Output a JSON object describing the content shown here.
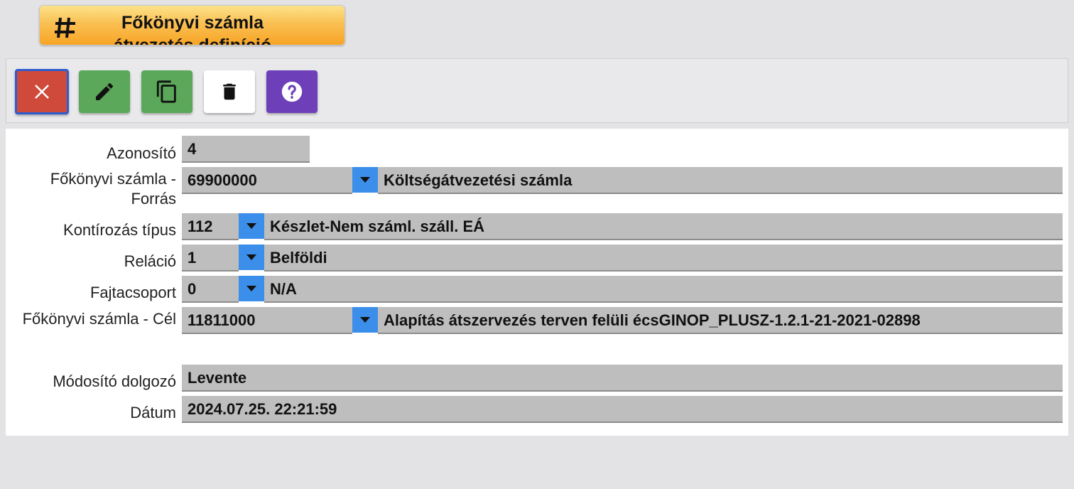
{
  "tab": {
    "title": "Főkönyvi számla átvezetés definíció",
    "icon": "hashtag-icon"
  },
  "toolbar": {
    "close": {
      "icon": "close-icon",
      "color": "#d04a3b"
    },
    "edit": {
      "icon": "pencil-icon",
      "color": "#5ba85a"
    },
    "copy": {
      "icon": "copy-icon",
      "color": "#5ba85a"
    },
    "delete": {
      "icon": "trash-icon",
      "color": "#ffffff"
    },
    "help": {
      "icon": "help-icon",
      "color": "#6d3fb8"
    }
  },
  "form": {
    "id": {
      "label": "Azonosító",
      "value": "4"
    },
    "source_account": {
      "label": "Főkönyvi számla - Forrás",
      "code": "69900000",
      "name": "Költségátvezetési számla"
    },
    "posting_type": {
      "label": "Kontírozás típus",
      "code": "112",
      "name": "Készlet-Nem száml. száll. EÁ"
    },
    "relation": {
      "label": "Reláció",
      "code": "1",
      "name": "Belföldi"
    },
    "type_group": {
      "label": "Fajtacsoport",
      "code": "0",
      "name": "N/A"
    },
    "target_account": {
      "label": "Főkönyvi számla - Cél",
      "code": "11811000",
      "name": "Alapítás átszervezés terven felüli écsGINOP_PLUSZ-1.2.1-21-2021-02898"
    },
    "modifier": {
      "label": "Módosító dolgozó",
      "value": "Levente"
    },
    "date": {
      "label": "Dátum",
      "value": "2024.07.25. 22:21:59"
    }
  },
  "colors": {
    "dropdown": "#3b8eea",
    "field_bg": "#bebebe",
    "tab_accent": "#f7a425"
  }
}
